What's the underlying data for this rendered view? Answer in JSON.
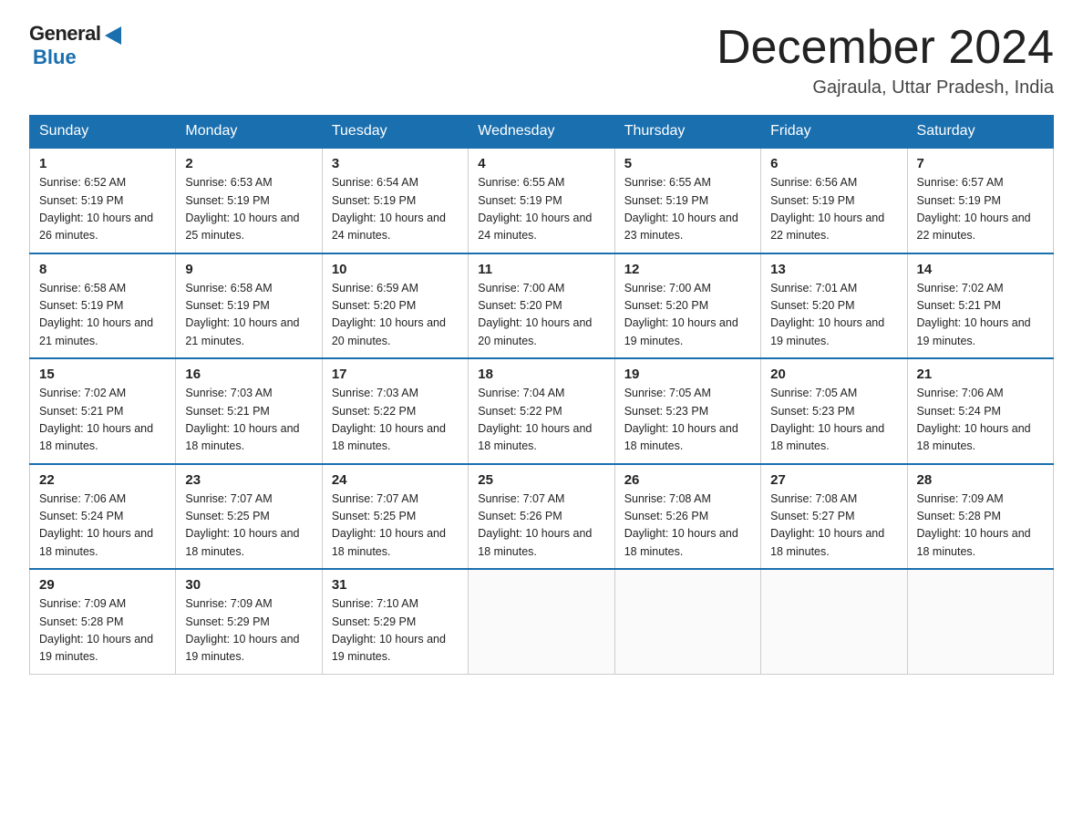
{
  "header": {
    "logo_general": "General",
    "logo_blue": "Blue",
    "month_title": "December 2024",
    "location": "Gajraula, Uttar Pradesh, India"
  },
  "days_of_week": [
    "Sunday",
    "Monday",
    "Tuesday",
    "Wednesday",
    "Thursday",
    "Friday",
    "Saturday"
  ],
  "weeks": [
    [
      {
        "day": "1",
        "sunrise": "6:52 AM",
        "sunset": "5:19 PM",
        "daylight": "10 hours and 26 minutes."
      },
      {
        "day": "2",
        "sunrise": "6:53 AM",
        "sunset": "5:19 PM",
        "daylight": "10 hours and 25 minutes."
      },
      {
        "day": "3",
        "sunrise": "6:54 AM",
        "sunset": "5:19 PM",
        "daylight": "10 hours and 24 minutes."
      },
      {
        "day": "4",
        "sunrise": "6:55 AM",
        "sunset": "5:19 PM",
        "daylight": "10 hours and 24 minutes."
      },
      {
        "day": "5",
        "sunrise": "6:55 AM",
        "sunset": "5:19 PM",
        "daylight": "10 hours and 23 minutes."
      },
      {
        "day": "6",
        "sunrise": "6:56 AM",
        "sunset": "5:19 PM",
        "daylight": "10 hours and 22 minutes."
      },
      {
        "day": "7",
        "sunrise": "6:57 AM",
        "sunset": "5:19 PM",
        "daylight": "10 hours and 22 minutes."
      }
    ],
    [
      {
        "day": "8",
        "sunrise": "6:58 AM",
        "sunset": "5:19 PM",
        "daylight": "10 hours and 21 minutes."
      },
      {
        "day": "9",
        "sunrise": "6:58 AM",
        "sunset": "5:19 PM",
        "daylight": "10 hours and 21 minutes."
      },
      {
        "day": "10",
        "sunrise": "6:59 AM",
        "sunset": "5:20 PM",
        "daylight": "10 hours and 20 minutes."
      },
      {
        "day": "11",
        "sunrise": "7:00 AM",
        "sunset": "5:20 PM",
        "daylight": "10 hours and 20 minutes."
      },
      {
        "day": "12",
        "sunrise": "7:00 AM",
        "sunset": "5:20 PM",
        "daylight": "10 hours and 19 minutes."
      },
      {
        "day": "13",
        "sunrise": "7:01 AM",
        "sunset": "5:20 PM",
        "daylight": "10 hours and 19 minutes."
      },
      {
        "day": "14",
        "sunrise": "7:02 AM",
        "sunset": "5:21 PM",
        "daylight": "10 hours and 19 minutes."
      }
    ],
    [
      {
        "day": "15",
        "sunrise": "7:02 AM",
        "sunset": "5:21 PM",
        "daylight": "10 hours and 18 minutes."
      },
      {
        "day": "16",
        "sunrise": "7:03 AM",
        "sunset": "5:21 PM",
        "daylight": "10 hours and 18 minutes."
      },
      {
        "day": "17",
        "sunrise": "7:03 AM",
        "sunset": "5:22 PM",
        "daylight": "10 hours and 18 minutes."
      },
      {
        "day": "18",
        "sunrise": "7:04 AM",
        "sunset": "5:22 PM",
        "daylight": "10 hours and 18 minutes."
      },
      {
        "day": "19",
        "sunrise": "7:05 AM",
        "sunset": "5:23 PM",
        "daylight": "10 hours and 18 minutes."
      },
      {
        "day": "20",
        "sunrise": "7:05 AM",
        "sunset": "5:23 PM",
        "daylight": "10 hours and 18 minutes."
      },
      {
        "day": "21",
        "sunrise": "7:06 AM",
        "sunset": "5:24 PM",
        "daylight": "10 hours and 18 minutes."
      }
    ],
    [
      {
        "day": "22",
        "sunrise": "7:06 AM",
        "sunset": "5:24 PM",
        "daylight": "10 hours and 18 minutes."
      },
      {
        "day": "23",
        "sunrise": "7:07 AM",
        "sunset": "5:25 PM",
        "daylight": "10 hours and 18 minutes."
      },
      {
        "day": "24",
        "sunrise": "7:07 AM",
        "sunset": "5:25 PM",
        "daylight": "10 hours and 18 minutes."
      },
      {
        "day": "25",
        "sunrise": "7:07 AM",
        "sunset": "5:26 PM",
        "daylight": "10 hours and 18 minutes."
      },
      {
        "day": "26",
        "sunrise": "7:08 AM",
        "sunset": "5:26 PM",
        "daylight": "10 hours and 18 minutes."
      },
      {
        "day": "27",
        "sunrise": "7:08 AM",
        "sunset": "5:27 PM",
        "daylight": "10 hours and 18 minutes."
      },
      {
        "day": "28",
        "sunrise": "7:09 AM",
        "sunset": "5:28 PM",
        "daylight": "10 hours and 18 minutes."
      }
    ],
    [
      {
        "day": "29",
        "sunrise": "7:09 AM",
        "sunset": "5:28 PM",
        "daylight": "10 hours and 19 minutes."
      },
      {
        "day": "30",
        "sunrise": "7:09 AM",
        "sunset": "5:29 PM",
        "daylight": "10 hours and 19 minutes."
      },
      {
        "day": "31",
        "sunrise": "7:10 AM",
        "sunset": "5:29 PM",
        "daylight": "10 hours and 19 minutes."
      },
      null,
      null,
      null,
      null
    ]
  ]
}
